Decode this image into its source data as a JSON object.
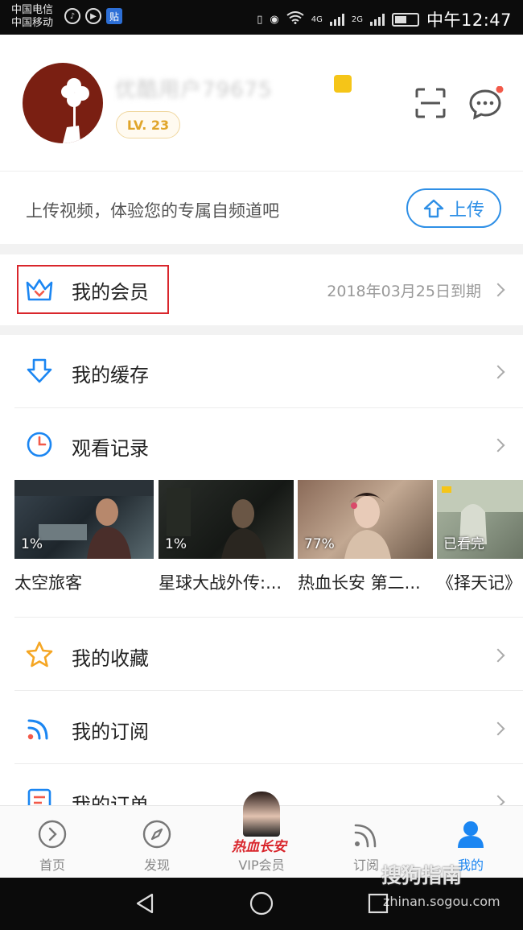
{
  "status_bar": {
    "carrier_1": "中国电信",
    "carrier_2": "中国移动",
    "network_1": "4G",
    "network_2": "2G",
    "time": "中午12:47",
    "tie_label": "贴"
  },
  "profile": {
    "username": "优酷用户79675",
    "level": "LV. 23"
  },
  "upload": {
    "prompt": "上传视频，体验您的专属自频道吧",
    "button_label": "上传"
  },
  "membership": {
    "label": "我的会员",
    "expiry": "2018年03月25日到期"
  },
  "menu": {
    "cache": "我的缓存",
    "history": "观看记录",
    "favorites": "我的收藏",
    "subscriptions": "我的订阅",
    "orders": "我的订单"
  },
  "history_items": [
    {
      "title": "太空旅客",
      "progress": "1%"
    },
    {
      "title": "星球大战外传:...",
      "progress": "1%"
    },
    {
      "title": "热血长安 第二...",
      "progress": "77%"
    },
    {
      "title": "《择天记》",
      "progress": "已看完"
    }
  ],
  "bottom_nav": {
    "home": "首页",
    "discover": "发现",
    "vip": "VIP会员",
    "vip_banner": "热血长安",
    "subscribe": "订阅",
    "mine": "我的"
  },
  "watermark": {
    "brand": "搜狗指南",
    "url": "zhinan.sogou.com"
  },
  "colors": {
    "accent_blue": "#1b86f2",
    "highlight_red": "#d9262c",
    "level_gold": "#e0a52a"
  }
}
